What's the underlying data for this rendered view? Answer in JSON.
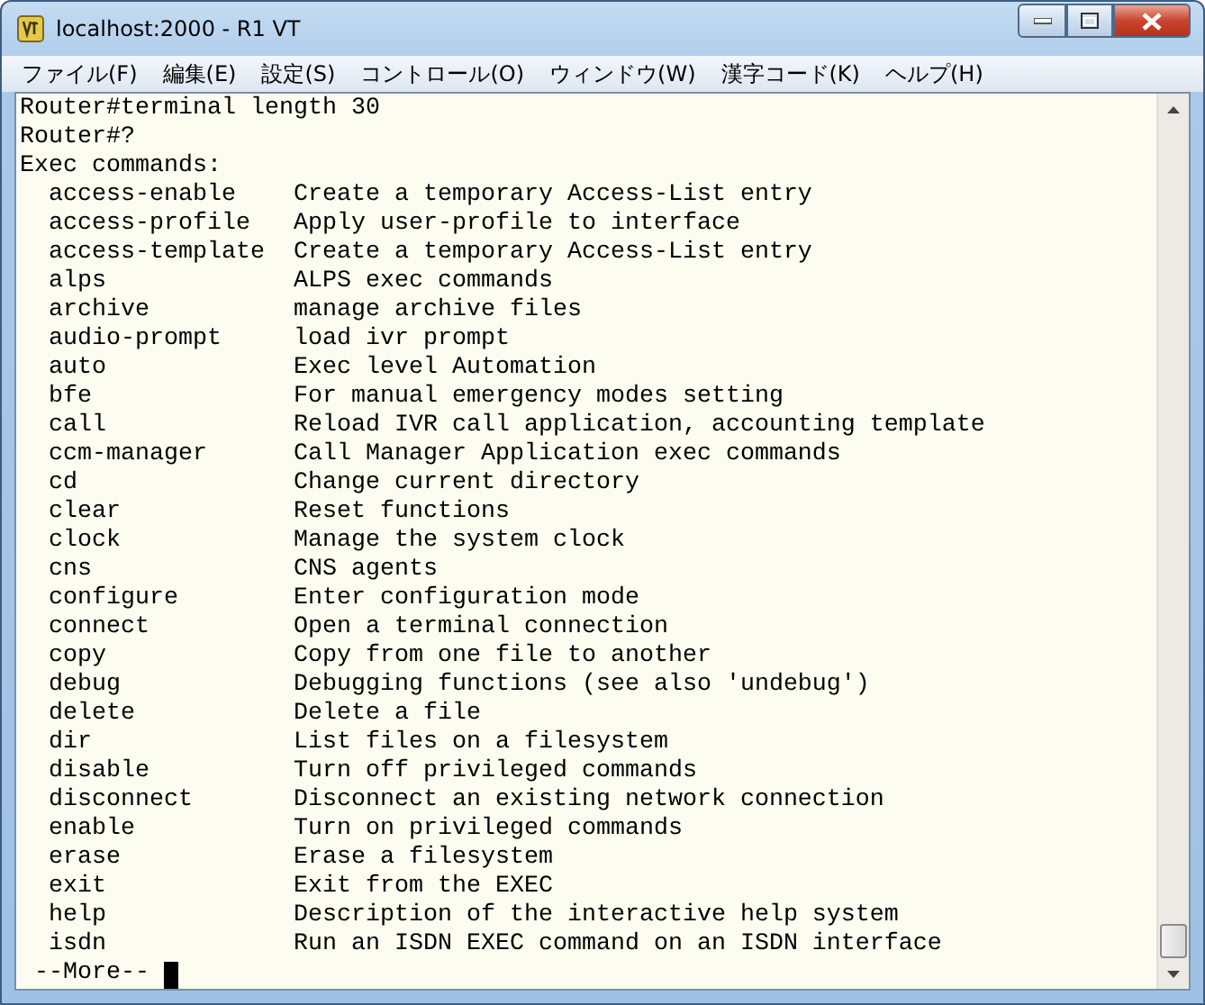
{
  "window": {
    "title": "localhost:2000 - R1 VT"
  },
  "menu": [
    "ファイル(F)",
    "編集(E)",
    "設定(S)",
    "コントロール(O)",
    "ウィンドウ(W)",
    "漢字コード(K)",
    "ヘルプ(H)"
  ],
  "terminal": {
    "header_lines": [
      "Router#terminal length 30",
      "Router#?",
      "Exec commands:"
    ],
    "commands": [
      {
        "command": "access-enable",
        "description": "Create a temporary Access-List entry"
      },
      {
        "command": "access-profile",
        "description": "Apply user-profile to interface"
      },
      {
        "command": "access-template",
        "description": "Create a temporary Access-List entry"
      },
      {
        "command": "alps",
        "description": "ALPS exec commands"
      },
      {
        "command": "archive",
        "description": "manage archive files"
      },
      {
        "command": "audio-prompt",
        "description": "load ivr prompt"
      },
      {
        "command": "auto",
        "description": "Exec level Automation"
      },
      {
        "command": "bfe",
        "description": "For manual emergency modes setting"
      },
      {
        "command": "call",
        "description": "Reload IVR call application, accounting template"
      },
      {
        "command": "ccm-manager",
        "description": "Call Manager Application exec commands"
      },
      {
        "command": "cd",
        "description": "Change current directory"
      },
      {
        "command": "clear",
        "description": "Reset functions"
      },
      {
        "command": "clock",
        "description": "Manage the system clock"
      },
      {
        "command": "cns",
        "description": "CNS agents"
      },
      {
        "command": "configure",
        "description": "Enter configuration mode"
      },
      {
        "command": "connect",
        "description": "Open a terminal connection"
      },
      {
        "command": "copy",
        "description": "Copy from one file to another"
      },
      {
        "command": "debug",
        "description": "Debugging functions (see also 'undebug')"
      },
      {
        "command": "delete",
        "description": "Delete a file"
      },
      {
        "command": "dir",
        "description": "List files on a filesystem"
      },
      {
        "command": "disable",
        "description": "Turn off privileged commands"
      },
      {
        "command": "disconnect",
        "description": "Disconnect an existing network connection"
      },
      {
        "command": "enable",
        "description": "Turn on privileged commands"
      },
      {
        "command": "erase",
        "description": "Erase a filesystem"
      },
      {
        "command": "exit",
        "description": "Exit from the EXEC"
      },
      {
        "command": "help",
        "description": "Description of the interactive help system"
      },
      {
        "command": "isdn",
        "description": "Run an ISDN EXEC command on an ISDN interface"
      }
    ],
    "pager_prompt": "--More--"
  }
}
